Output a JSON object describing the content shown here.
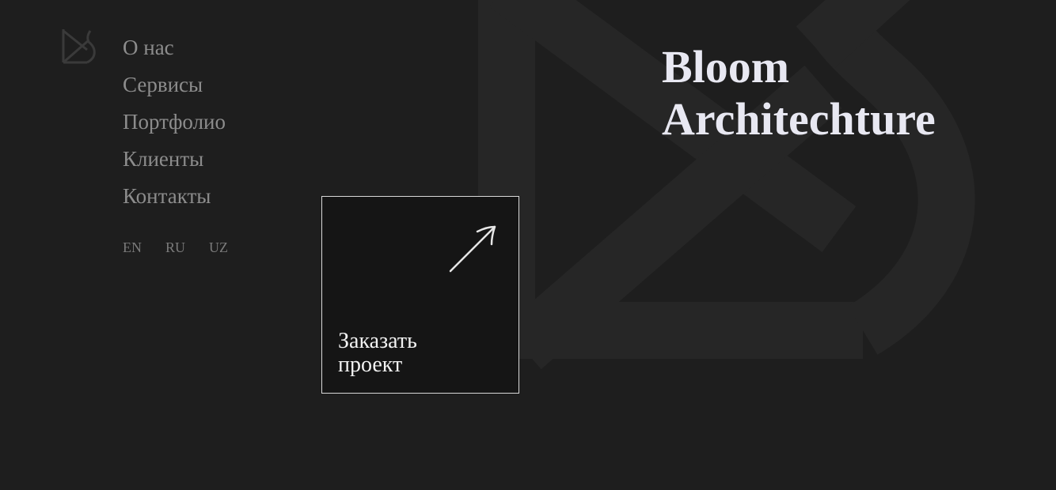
{
  "brand": {
    "logo_icon": "bloom-architecture-logo",
    "title_line1": "Bloom",
    "title_line2": "Architechture"
  },
  "nav": {
    "items": [
      {
        "label": "О нас"
      },
      {
        "label": "Сервисы"
      },
      {
        "label": "Портфолио"
      },
      {
        "label": "Клиенты"
      },
      {
        "label": "Контакты"
      }
    ]
  },
  "languages": [
    "EN",
    "RU",
    "UZ"
  ],
  "cta": {
    "label_line1": "Заказать",
    "label_line2": "проект",
    "icon": "arrow-up-right-icon"
  },
  "colors": {
    "background": "#1e1e1e",
    "background_logo": "#262626",
    "nav_text": "#8c8c8c",
    "title_text": "#e8e8f2",
    "cta_background": "#151515",
    "cta_border": "#d9d9d9"
  }
}
